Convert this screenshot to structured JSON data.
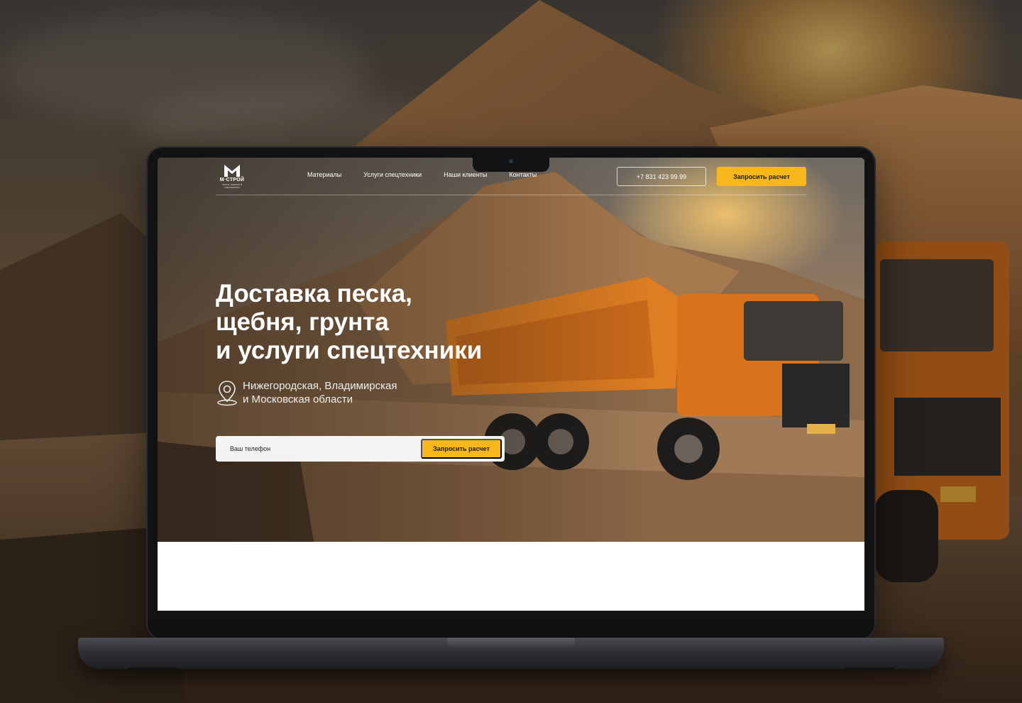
{
  "colors": {
    "accent": "#f8b71c",
    "text_light": "#ffffff",
    "laptop_body": "#111214"
  },
  "logo": {
    "name": "М·СТРОЙ",
    "tagline": "ПЕСОК, ЩЕБЕНЬ И СПЕЦТЕХНИКА"
  },
  "nav": {
    "items": [
      {
        "label": "Материалы"
      },
      {
        "label": "Услуги спецтехники"
      },
      {
        "label": "Наши клиенты"
      },
      {
        "label": "Контакты"
      }
    ]
  },
  "header": {
    "phone": "+7 831 423 99 99",
    "cta_label": "Запросить расчет"
  },
  "hero": {
    "title": "Доставка песка,\nщебня, грунта\nи услуги спецтехники",
    "region": "Нижегородская, Владимирская\nи Московская области",
    "region_icon": "map-pin-icon",
    "form": {
      "phone_placeholder": "Ваш телефон",
      "submit_label": "Запросить расчет"
    }
  }
}
